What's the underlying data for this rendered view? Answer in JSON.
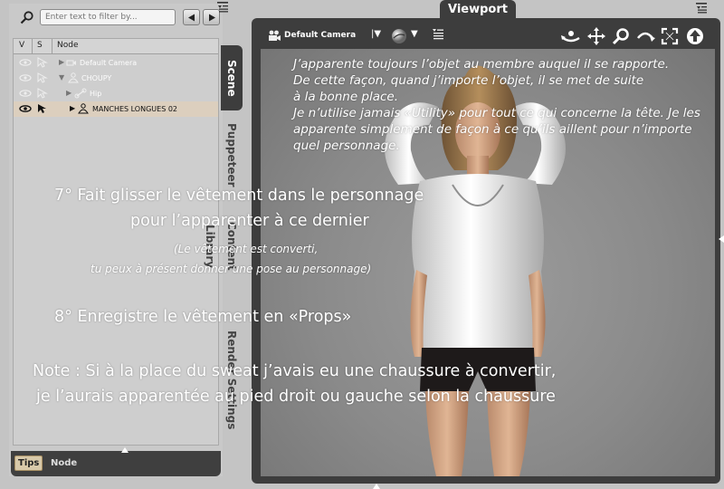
{
  "scene_panel": {
    "filter_placeholder": "Enter text to filter by...",
    "columns": {
      "visible": "V",
      "selectable": "S",
      "node": "Node"
    },
    "nodes": [
      {
        "label": "Default Camera",
        "icon": "camera-icon"
      },
      {
        "label": "CHOUPY",
        "icon": "figure-icon"
      },
      {
        "label": "Hip",
        "icon": "bone-icon"
      },
      {
        "label": "MANCHES LONGUES 02",
        "icon": "figure-icon"
      }
    ],
    "bottom_tabs": {
      "tips": "Tips",
      "node": "Node"
    }
  },
  "vertical_tabs": {
    "scene": "Scene",
    "puppeteer": "Puppeteer",
    "content_library": "Content Library",
    "render_settings": "Render Settings"
  },
  "viewport": {
    "tab_label": "Viewport",
    "camera_label": "Default Camera",
    "tools": [
      "orbit-icon",
      "move-icon",
      "zoom-icon",
      "roll-icon",
      "frame-icon",
      "home-icon"
    ]
  },
  "annotations": {
    "instructions": [
      "J’apparente toujours l’objet au membre auquel il se rapporte.",
      "De cette façon, quand j’importe l’objet, il se met de suite",
      "à la bonne place.",
      "Je n’utilise jamais «Utility» pour tout ce qui concerne la tête. Je les",
      "apparente simplement de façon à ce qu’ils aillent pour n’importe",
      "quel personnage."
    ],
    "step7_line1": "7°   Fait glisser le vêtement dans le personnage",
    "step7_line2": "pour l’apparenter à ce dernier",
    "step7_note1": "(Le vêtement est converti,",
    "step7_note2": "tu peux à présent donner une pose au personnage)",
    "step8": "8°   Enregistre le vêtement en «Props»",
    "note_line1": "Note :  Si à la place du sweat j’avais eu une chaussure à convertir,",
    "note_line2": "je l’aurais apparentée au pied droit ou gauche selon la chaussure"
  },
  "colors": {
    "panel_dark": "#3d3d3d",
    "panel_light": "#c9c9c9",
    "selected_row": "#dccfbe",
    "tips_tab": "#d8c9a9"
  }
}
